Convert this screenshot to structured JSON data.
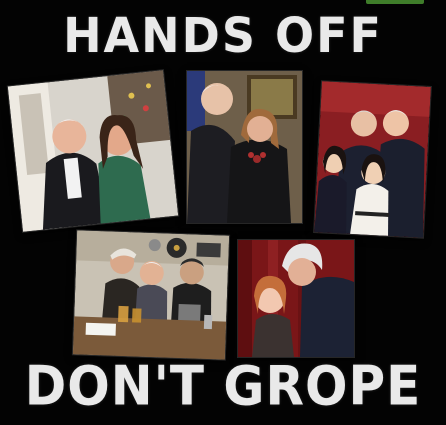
{
  "headline_top": "HANDS OFF",
  "headline_bottom": "DON'T GROPE",
  "colors": {
    "background": "#030303",
    "headline": "#e9e9e9",
    "corner_accent": "#3f7d2a"
  },
  "photos": [
    {
      "name": "photo-couple-christmas"
    },
    {
      "name": "photo-woman-black-dress"
    },
    {
      "name": "photo-children-group"
    },
    {
      "name": "photo-diner-table"
    },
    {
      "name": "photo-girl-red-curtain"
    }
  ]
}
